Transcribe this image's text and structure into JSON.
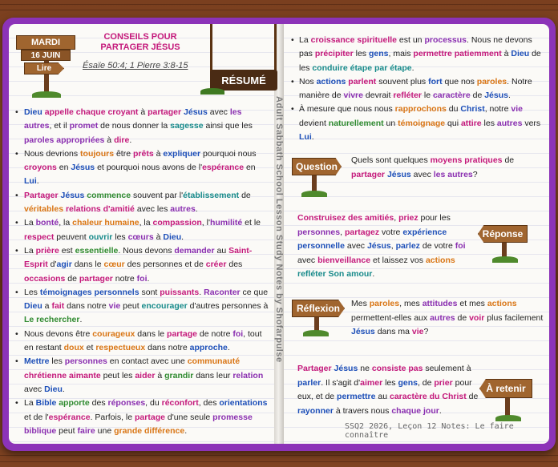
{
  "header": {
    "day": "MARDI",
    "date": "16 JUIN",
    "read_label": "Lire",
    "title": "CONSEILS POUR PARTAGER JÉSUS",
    "refs": "Ésaïe 50:4; 1 Pierre 3:8-15",
    "resume": "RÉSUMÉ"
  },
  "vertical_text": "Adult Sabbath School Lesson Study Notes by Shofarpulse",
  "footer": "SSQ2 2026, Leçon 12 Notes: Le faire connaître",
  "signs": {
    "question": "Question",
    "reponse": "Réponse",
    "reflexion": "Réflexion",
    "retenir": "À retenir"
  },
  "colors": {
    "cover": "#8c33b8",
    "blue": "#1d4fb8",
    "orange": "#d97514",
    "magenta": "#c4197b",
    "green": "#2f8a2f",
    "purple": "#8a2fb0",
    "teal": "#178a8a"
  }
}
